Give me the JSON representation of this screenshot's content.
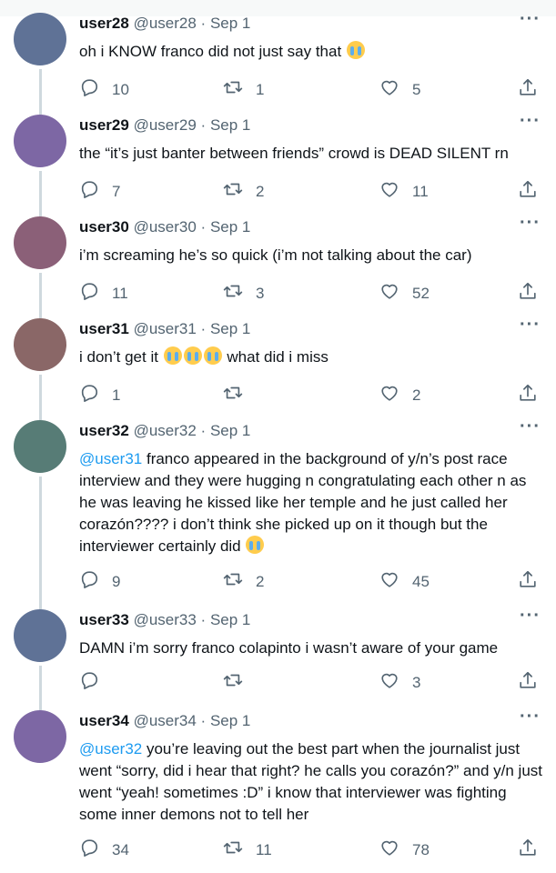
{
  "tweets": [
    {
      "username": "user28",
      "handle": "@user28",
      "separator": "·",
      "date": "Sep 1",
      "mention": "",
      "text": "oh i KNOW franco did not just say that ",
      "emoji_count": 1,
      "text_after_emoji": "",
      "reply_count": "10",
      "retweet_count": "1",
      "like_count": "5",
      "avatar_color": "#5f7296"
    },
    {
      "username": "user29",
      "handle": "@user29",
      "separator": "·",
      "date": "Sep 1",
      "mention": "",
      "text": "the “it’s just banter between friends” crowd is DEAD SILENT rn",
      "emoji_count": 0,
      "text_after_emoji": "",
      "reply_count": "7",
      "retweet_count": "2",
      "like_count": "11",
      "avatar_color": "#7d67a4"
    },
    {
      "username": "user30",
      "handle": "@user30",
      "separator": "·",
      "date": "Sep 1",
      "mention": "",
      "text": "i’m screaming he’s so quick (i’m not talking about the car)",
      "emoji_count": 0,
      "text_after_emoji": "",
      "reply_count": "11",
      "retweet_count": "3",
      "like_count": "52",
      "avatar_color": "#8b6078"
    },
    {
      "username": "user31",
      "handle": "@user31",
      "separator": "·",
      "date": "Sep 1",
      "mention": "",
      "text": "i don’t get it ",
      "emoji_count": 3,
      "text_after_emoji": " what did i miss",
      "reply_count": "1",
      "retweet_count": "",
      "like_count": "2",
      "avatar_color": "#8a6767"
    },
    {
      "username": "user32",
      "handle": "@user32",
      "separator": "·",
      "date": "Sep 1",
      "mention": "@user31",
      "text": " franco appeared in the background of y/n’s post race interview and they were hugging n congratulating each other n as he was leaving he kissed like her temple and he just called her corazón???? i don’t think she picked up on it though but the interviewer certainly did ",
      "emoji_count": 1,
      "text_after_emoji": "",
      "reply_count": "9",
      "retweet_count": "2",
      "like_count": "45",
      "avatar_color": "#577c76"
    },
    {
      "username": "user33",
      "handle": "@user33",
      "separator": "·",
      "date": "Sep 1",
      "mention": "",
      "text": "DAMN i’m sorry franco colapinto i wasn’t aware of your game",
      "emoji_count": 0,
      "text_after_emoji": "",
      "reply_count": "",
      "retweet_count": "",
      "like_count": "3",
      "avatar_color": "#5f7296"
    },
    {
      "username": "user34",
      "handle": "@user34",
      "separator": "·",
      "date": "Sep 1",
      "mention": "@user32",
      "text": " you’re leaving out the best part when the journalist just went “sorry, did i hear that right? he calls you corazón?” and y/n just went “yeah! sometimes :D” i know that interviewer was fighting some inner demons not to tell her",
      "emoji_count": 0,
      "text_after_emoji": "",
      "reply_count": "34",
      "retweet_count": "11",
      "like_count": "78",
      "avatar_color": "#7d67a4"
    }
  ],
  "icons": {
    "more": "more-dots-icon",
    "reply": "reply-icon",
    "retweet": "retweet-icon",
    "like": "heart-icon",
    "share": "share-icon"
  },
  "colors": {
    "mention": "#1d9bf0",
    "muted": "#536471",
    "thread_line": "#cfd9de"
  }
}
